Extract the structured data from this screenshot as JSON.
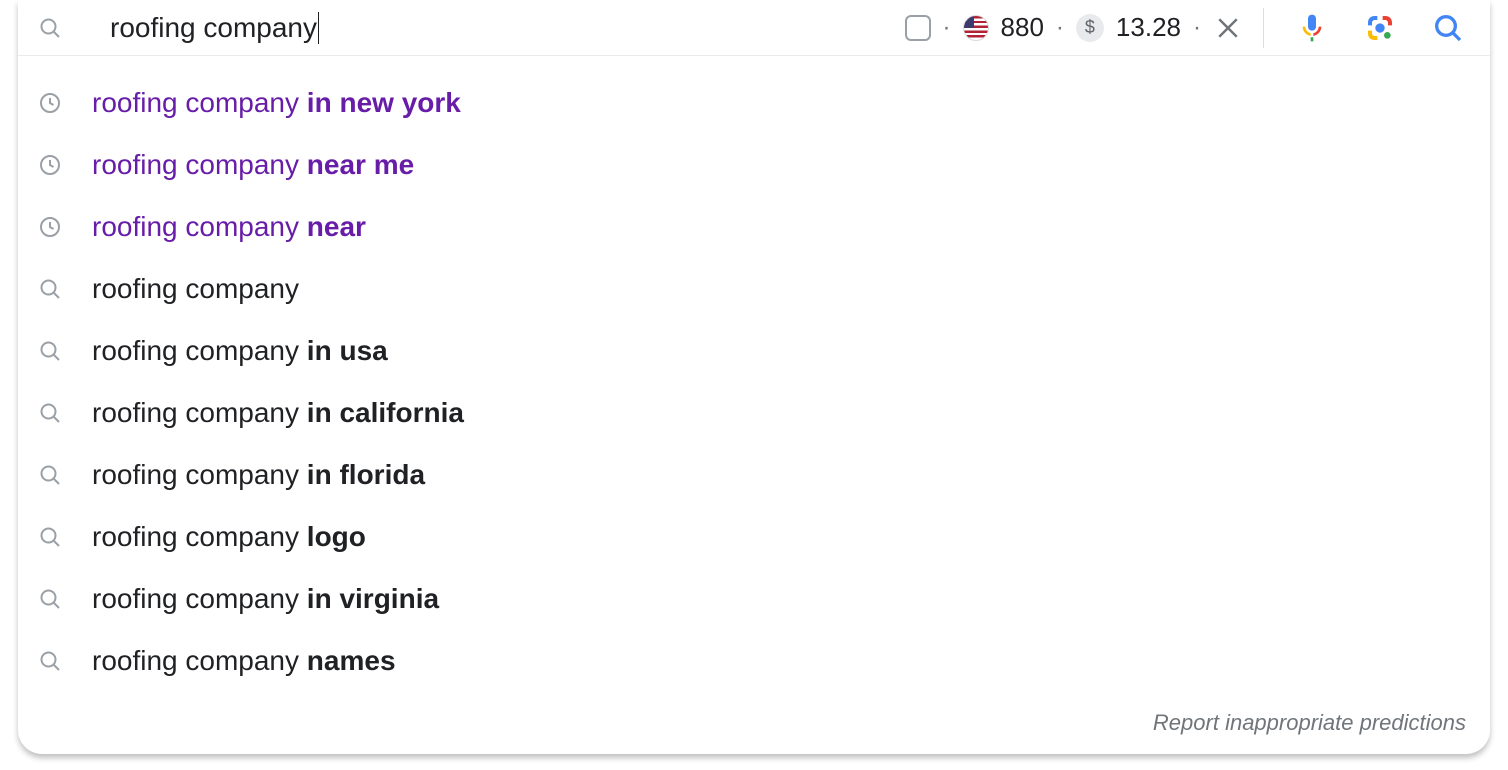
{
  "search": {
    "query": "roofing company",
    "metrics": {
      "volume": "880",
      "cpc": "13.28",
      "currency_symbol": "$"
    }
  },
  "suggestions": [
    {
      "icon": "clock",
      "visited": true,
      "prefix": "roofing company ",
      "bold": "in new york"
    },
    {
      "icon": "clock",
      "visited": true,
      "prefix": "roofing company ",
      "bold": "near me"
    },
    {
      "icon": "clock",
      "visited": true,
      "prefix": "roofing company ",
      "bold": "near"
    },
    {
      "icon": "search",
      "visited": false,
      "prefix": "roofing company",
      "bold": ""
    },
    {
      "icon": "search",
      "visited": false,
      "prefix": "roofing company ",
      "bold": "in usa"
    },
    {
      "icon": "search",
      "visited": false,
      "prefix": "roofing company ",
      "bold": "in california"
    },
    {
      "icon": "search",
      "visited": false,
      "prefix": "roofing company ",
      "bold": "in florida"
    },
    {
      "icon": "search",
      "visited": false,
      "prefix": "roofing company ",
      "bold": "logo"
    },
    {
      "icon": "search",
      "visited": false,
      "prefix": "roofing company ",
      "bold": "in virginia"
    },
    {
      "icon": "search",
      "visited": false,
      "prefix": "roofing company ",
      "bold": "names"
    }
  ],
  "footer": {
    "report_label": "Report inappropriate predictions"
  }
}
